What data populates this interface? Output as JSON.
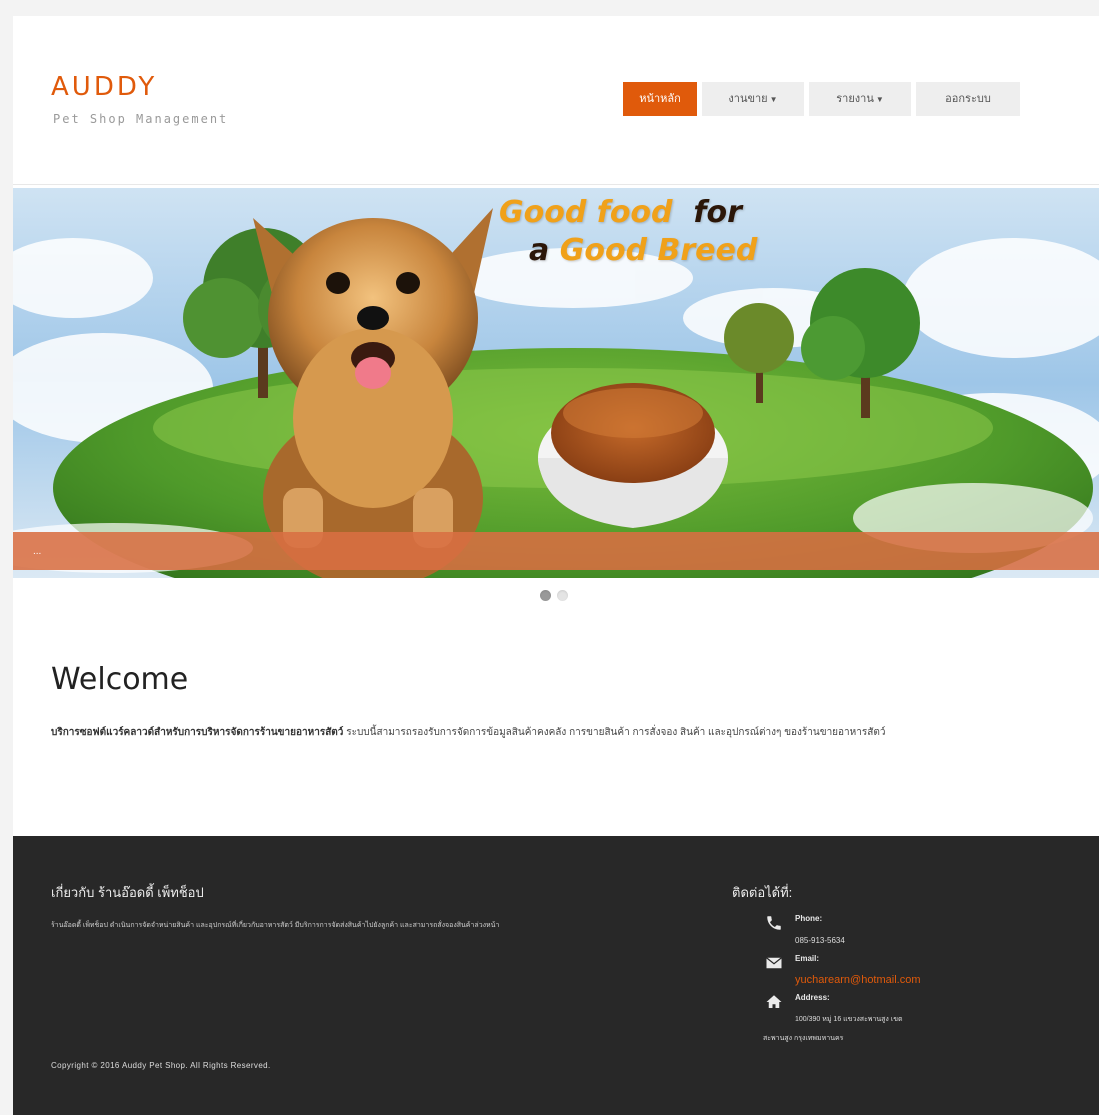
{
  "brand": {
    "title": "AUDDY",
    "subtitle": "Pet Shop Management"
  },
  "nav": {
    "items": [
      {
        "label": "หน้าหลัก",
        "active": true
      },
      {
        "label": "งานขาย",
        "caret": true
      },
      {
        "label": "รายงาน",
        "caret": true
      },
      {
        "label": "ออกระบบ"
      }
    ]
  },
  "banner": {
    "headline_line1_orange": "Good food",
    "headline_line1_dark": "for",
    "headline_line2_dark": "a",
    "headline_line2_orange": "Good Breed",
    "caption": "...",
    "slide_count": 2,
    "active_slide": 1
  },
  "welcome": {
    "title": "Welcome",
    "bold_text": "บริการซอฟต์แวร์คลาวด์สำหรับการบริหารจัดการร้านขายอาหารสัตว์",
    "text": " ระบบนี้สามารถรองรับการจัดการข้อมูลสินค้าคงคลัง การขายสินค้า การสั่งจอง สินค้า และอุปกรณ์ต่างๆ ของร้านขายอาหารสัตว์"
  },
  "footer": {
    "about_title": "เกี่ยวกับ ร้านอ๊อดดี้ เพ็ทช็อป",
    "about_text": "ร้านอ๊อดดี้ เพ็ทช็อป ดำเนินการจัดจำหน่ายสินค้า และอุปกรณ์ที่เกี่ยวกับอาหารสัตว์ มีบริการการจัดส่งสินค้าไปยังลูกค้า และสามารถสั่งจองสินค้าล่วงหน้า",
    "copyright": "Copyright © 2016 Auddy Pet Shop. All Rights Reserved.",
    "contact_title": "ติดต่อได้ที่:",
    "phone_label": "Phone:",
    "phone_value": "085-913-5634",
    "email_label": "Email:",
    "email_value": "yucharearn@hotmail.com",
    "address_label": "Address:",
    "address_line1": "100/390 หมู่ 16 แขวงสะพานสูง เขต",
    "address_line2": "สะพานสูง กรุงเทพมหานคร"
  },
  "colors": {
    "accent": "#e05a0b",
    "footer_bg": "#282828",
    "caption_bar": "#d86e42"
  }
}
